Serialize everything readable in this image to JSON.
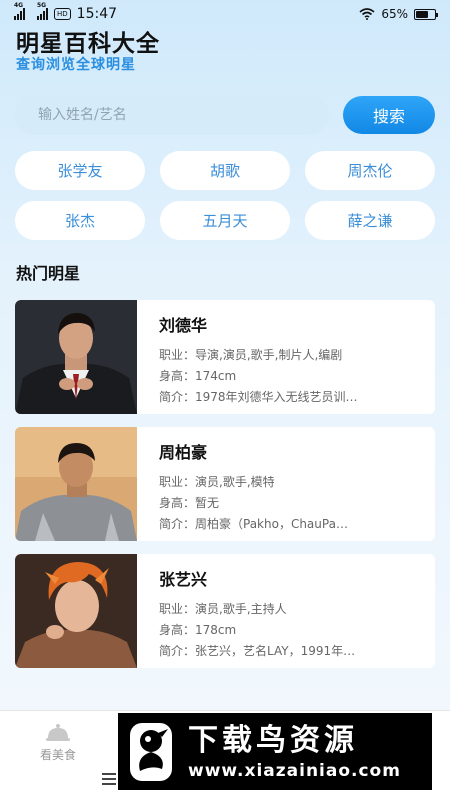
{
  "status_bar": {
    "network_1": "4G",
    "network_2": "5G",
    "hd": "HD",
    "time": "15:47",
    "battery": "65%",
    "battery_level": 0.65
  },
  "header": {
    "title": "明星百科大全",
    "subtitle": "查询浏览全球明星"
  },
  "search": {
    "placeholder": "输入姓名/艺名",
    "button_label": "搜索"
  },
  "quick_tags": [
    "张学友",
    "胡歌",
    "周杰伦",
    "张杰",
    "五月天",
    "薛之谦"
  ],
  "section_title": "热门明星",
  "stars": [
    {
      "name": "刘德华",
      "job": "职业：导演,演员,歌手,制片人,编剧",
      "height": "身高：174cm",
      "intro": "简介：1978年刘德华入无线艺员训…"
    },
    {
      "name": "周柏豪",
      "job": "职业：演员,歌手,模特",
      "height": "身高：暂无",
      "intro": "简介：周柏豪（Pakho，ChauPa…"
    },
    {
      "name": "张艺兴",
      "job": "职业：演员,歌手,主持人",
      "height": "身高：178cm",
      "intro": "简介：张艺兴，艺名LAY，1991年…"
    }
  ],
  "bottom_tab": {
    "food_label": "看美食"
  },
  "watermark": {
    "title": "下载鸟资源",
    "url": "www.xiazainiao.com"
  },
  "colors": {
    "accent": "#1b93ea",
    "chip_text": "#3b8ed8",
    "subtitle": "#2a8fe0"
  }
}
